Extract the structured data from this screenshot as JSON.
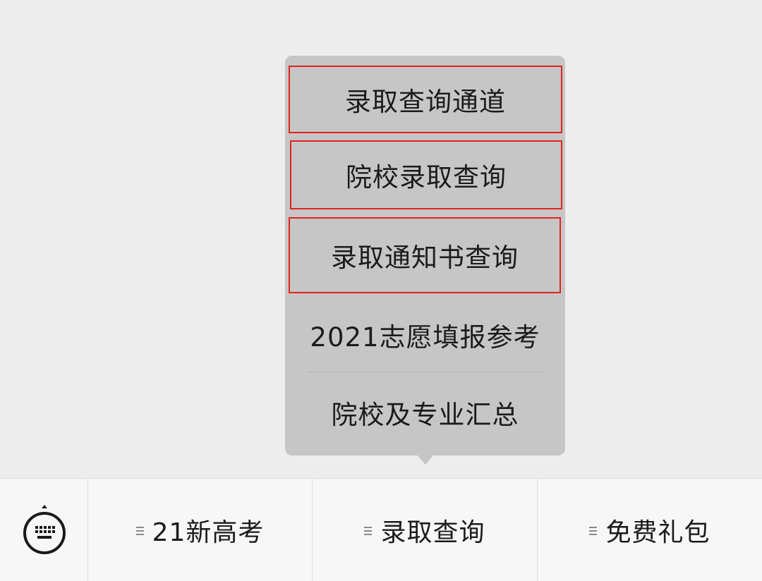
{
  "submenu": {
    "items": [
      {
        "label": "录取查询通道",
        "highlighted": true
      },
      {
        "label": "院校录取查询",
        "highlighted": true
      },
      {
        "label": "录取通知书查询",
        "highlighted": true
      },
      {
        "label": "2021志愿填报参考",
        "highlighted": false
      },
      {
        "label": "院校及专业汇总",
        "highlighted": false
      }
    ],
    "highlight_color": "#e0241c",
    "background_color": "#c6c6c6"
  },
  "menu_bar": {
    "keyboard_icon": "keyboard-icon",
    "buttons": [
      {
        "label": "21新高考",
        "icon": "menu-lines-icon"
      },
      {
        "label": "录取查询",
        "icon": "menu-lines-icon",
        "submenu_open": true
      },
      {
        "label": "免费礼包",
        "icon": "menu-lines-icon"
      }
    ]
  }
}
